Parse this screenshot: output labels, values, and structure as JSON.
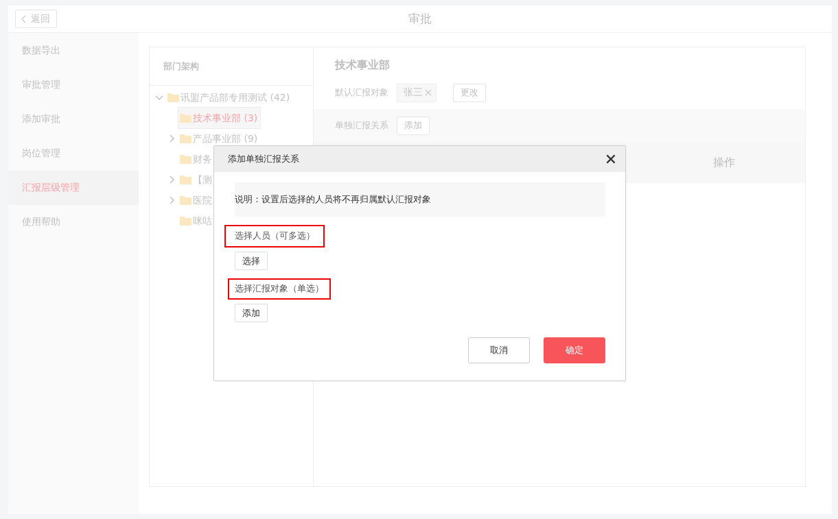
{
  "header": {
    "back_button": "返回",
    "title": "审批"
  },
  "sidebar": {
    "items": [
      {
        "label": "数据导出",
        "selected": false
      },
      {
        "label": "审批管理",
        "selected": false
      },
      {
        "label": "添加审批",
        "selected": false
      },
      {
        "label": "岗位管理",
        "selected": false
      },
      {
        "label": "汇报层级管理",
        "selected": true
      },
      {
        "label": "使用帮助",
        "selected": false
      }
    ]
  },
  "org_panel": {
    "title": "部门架构",
    "tree": [
      {
        "label": "讯盟产品部专用测试 (42)",
        "kind": "group",
        "expanded": true,
        "selected": false,
        "children": [
          {
            "label": "技术事业部 (3)",
            "kind": "leaf",
            "selected": true
          },
          {
            "label": "产品事业部 (9)",
            "kind": "group",
            "expanded": false,
            "selected": false
          },
          {
            "label": "财务",
            "kind": "leaf",
            "selected": false
          },
          {
            "label": "【测",
            "kind": "group",
            "expanded": false,
            "selected": false
          },
          {
            "label": "医院",
            "kind": "group",
            "expanded": false,
            "selected": false
          },
          {
            "label": "咪咕",
            "kind": "leaf",
            "selected": false
          }
        ]
      }
    ]
  },
  "detail": {
    "title": "技术事业部",
    "default_label": "默认汇报对象",
    "default_tag": "张三",
    "change_button": "更改",
    "separate_label": "单独汇报关系",
    "add_button": "添加",
    "table": {
      "columns": [
        "操作"
      ]
    }
  },
  "dialog": {
    "title": "添加单独汇报关系",
    "notice": "说明：设置后选择的人员将不再归属默认汇报对象",
    "sections": [
      {
        "label": "选择人员（可多选）",
        "button": "选择"
      },
      {
        "label": "选择汇报对象（单选）",
        "button": "添加"
      }
    ],
    "buttons": [
      {
        "label": "取消",
        "kind": "secondary"
      },
      {
        "label": "确定",
        "kind": "primary"
      }
    ]
  }
}
